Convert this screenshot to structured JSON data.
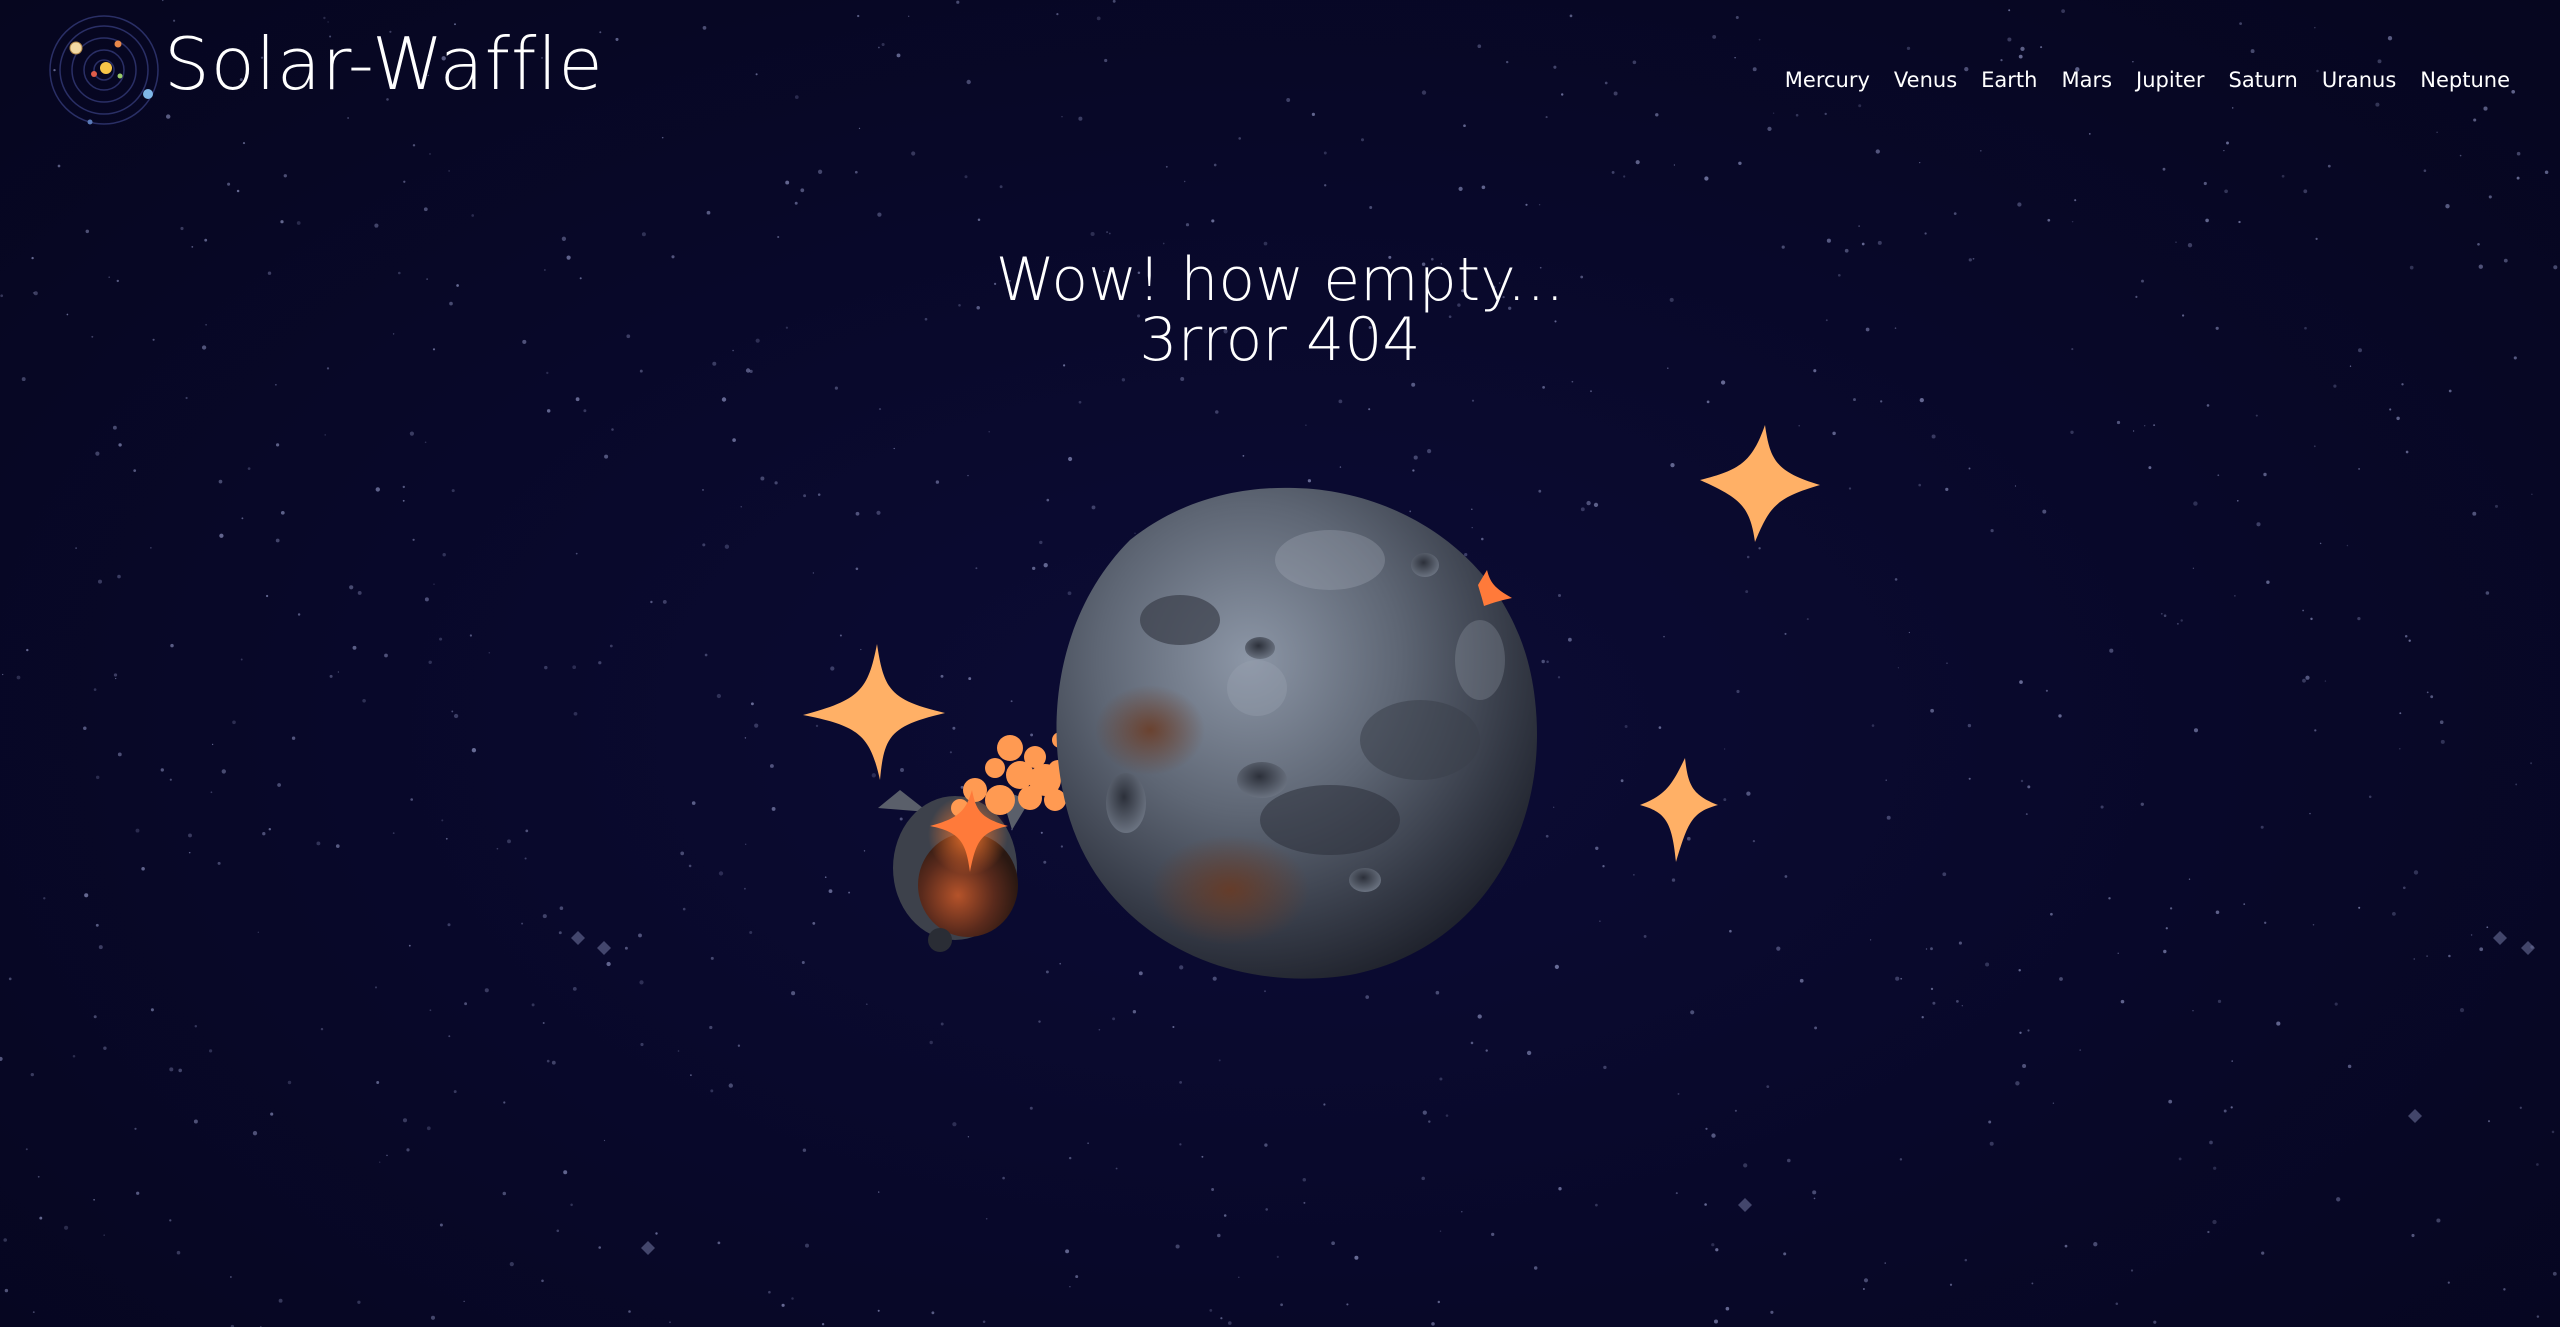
{
  "brand": {
    "name": "Solar-Waffle",
    "logo_icon": "solar-system-icon"
  },
  "nav": {
    "items": [
      {
        "label": "Mercury"
      },
      {
        "label": "Venus"
      },
      {
        "label": "Earth"
      },
      {
        "label": "Mars"
      },
      {
        "label": "Jupiter"
      },
      {
        "label": "Saturn"
      },
      {
        "label": "Uranus"
      },
      {
        "label": "Neptune"
      }
    ]
  },
  "error": {
    "headline": "Wow! how empty...",
    "code": "3rror 404"
  },
  "scene": {
    "asteroid_icon": "asteroid-icon",
    "rocket_icon": "crashed-rocket-icon",
    "sparkle_icon": "sparkle-star-icon",
    "star_color": "#ffb066",
    "background_color": "#070726"
  }
}
